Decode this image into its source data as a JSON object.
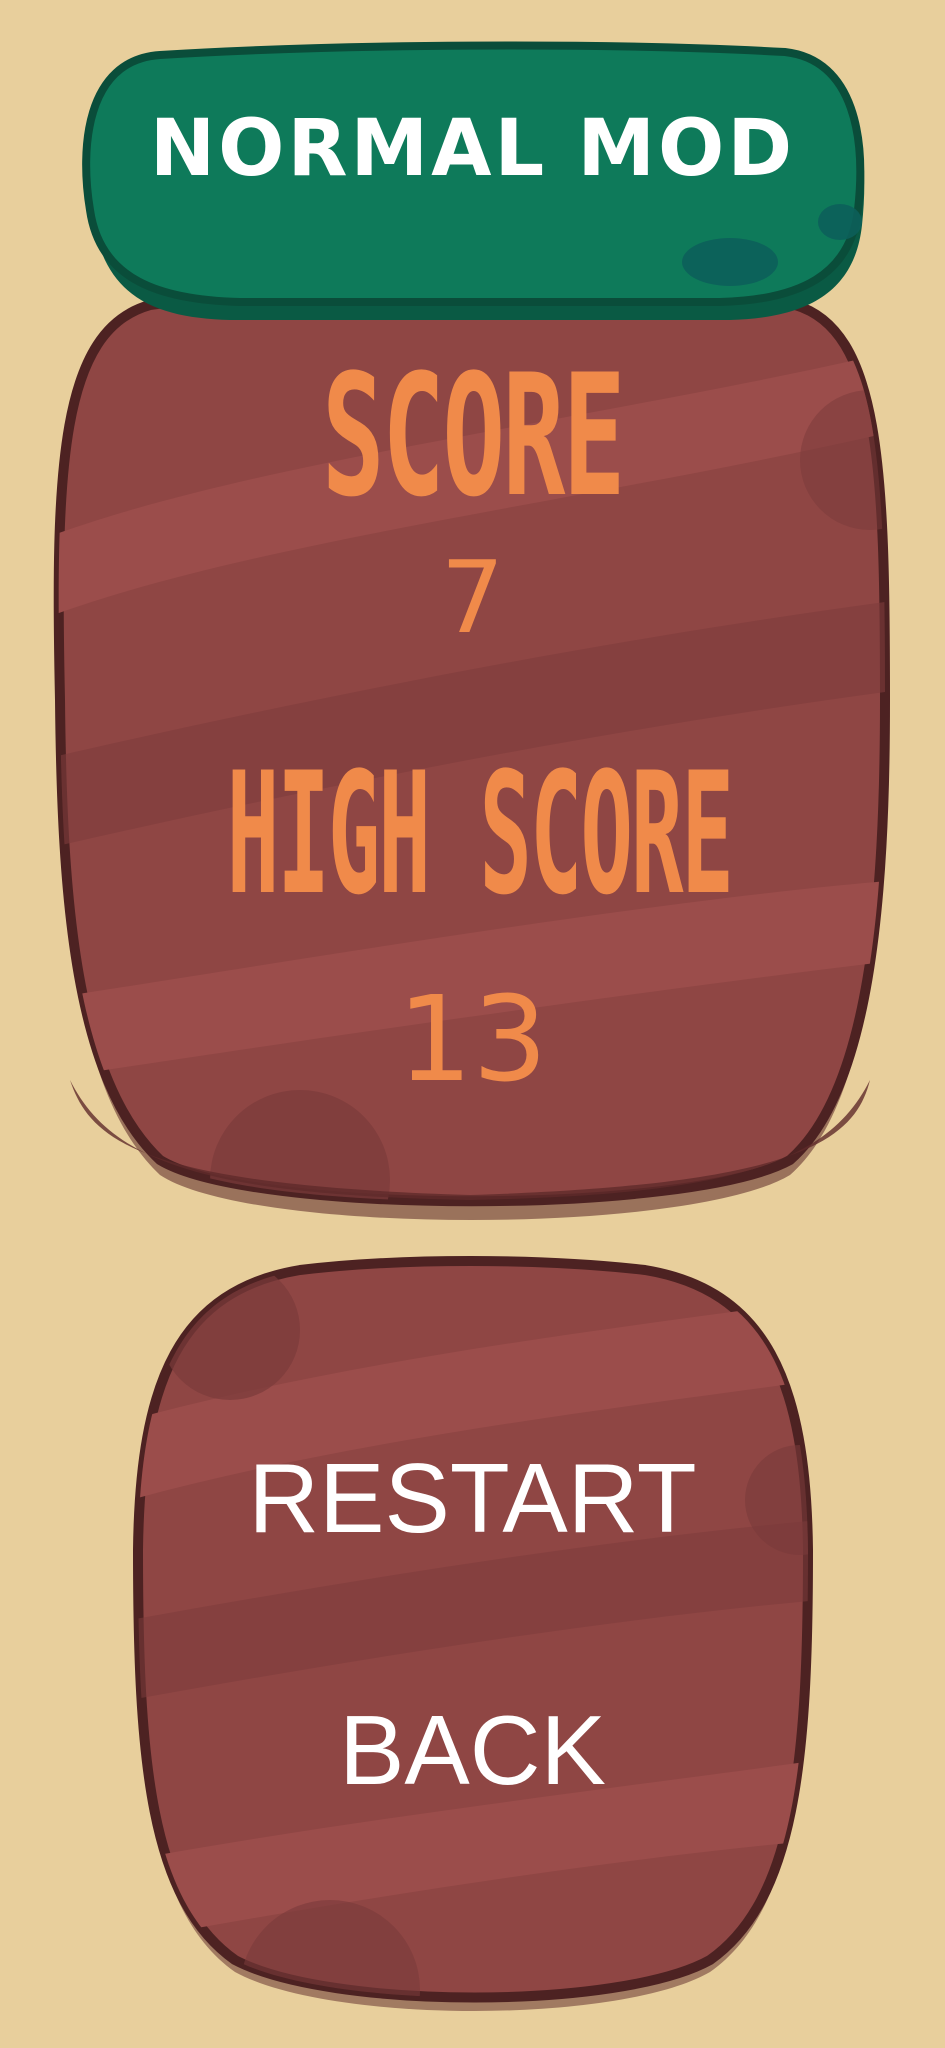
{
  "mode_banner": {
    "label": "NORMAL MOD"
  },
  "score_panel": {
    "score_label": "SCORE",
    "score_value": "7",
    "high_score_label": "HIGH SCORE",
    "high_score_value": "13"
  },
  "menu": {
    "restart_label": "RESTART",
    "back_label": "BACK"
  },
  "colors": {
    "background": "#e8cf9c",
    "banner": "#0e7a5a",
    "panel": "#8f4644",
    "accent_text": "#f08a4a"
  }
}
